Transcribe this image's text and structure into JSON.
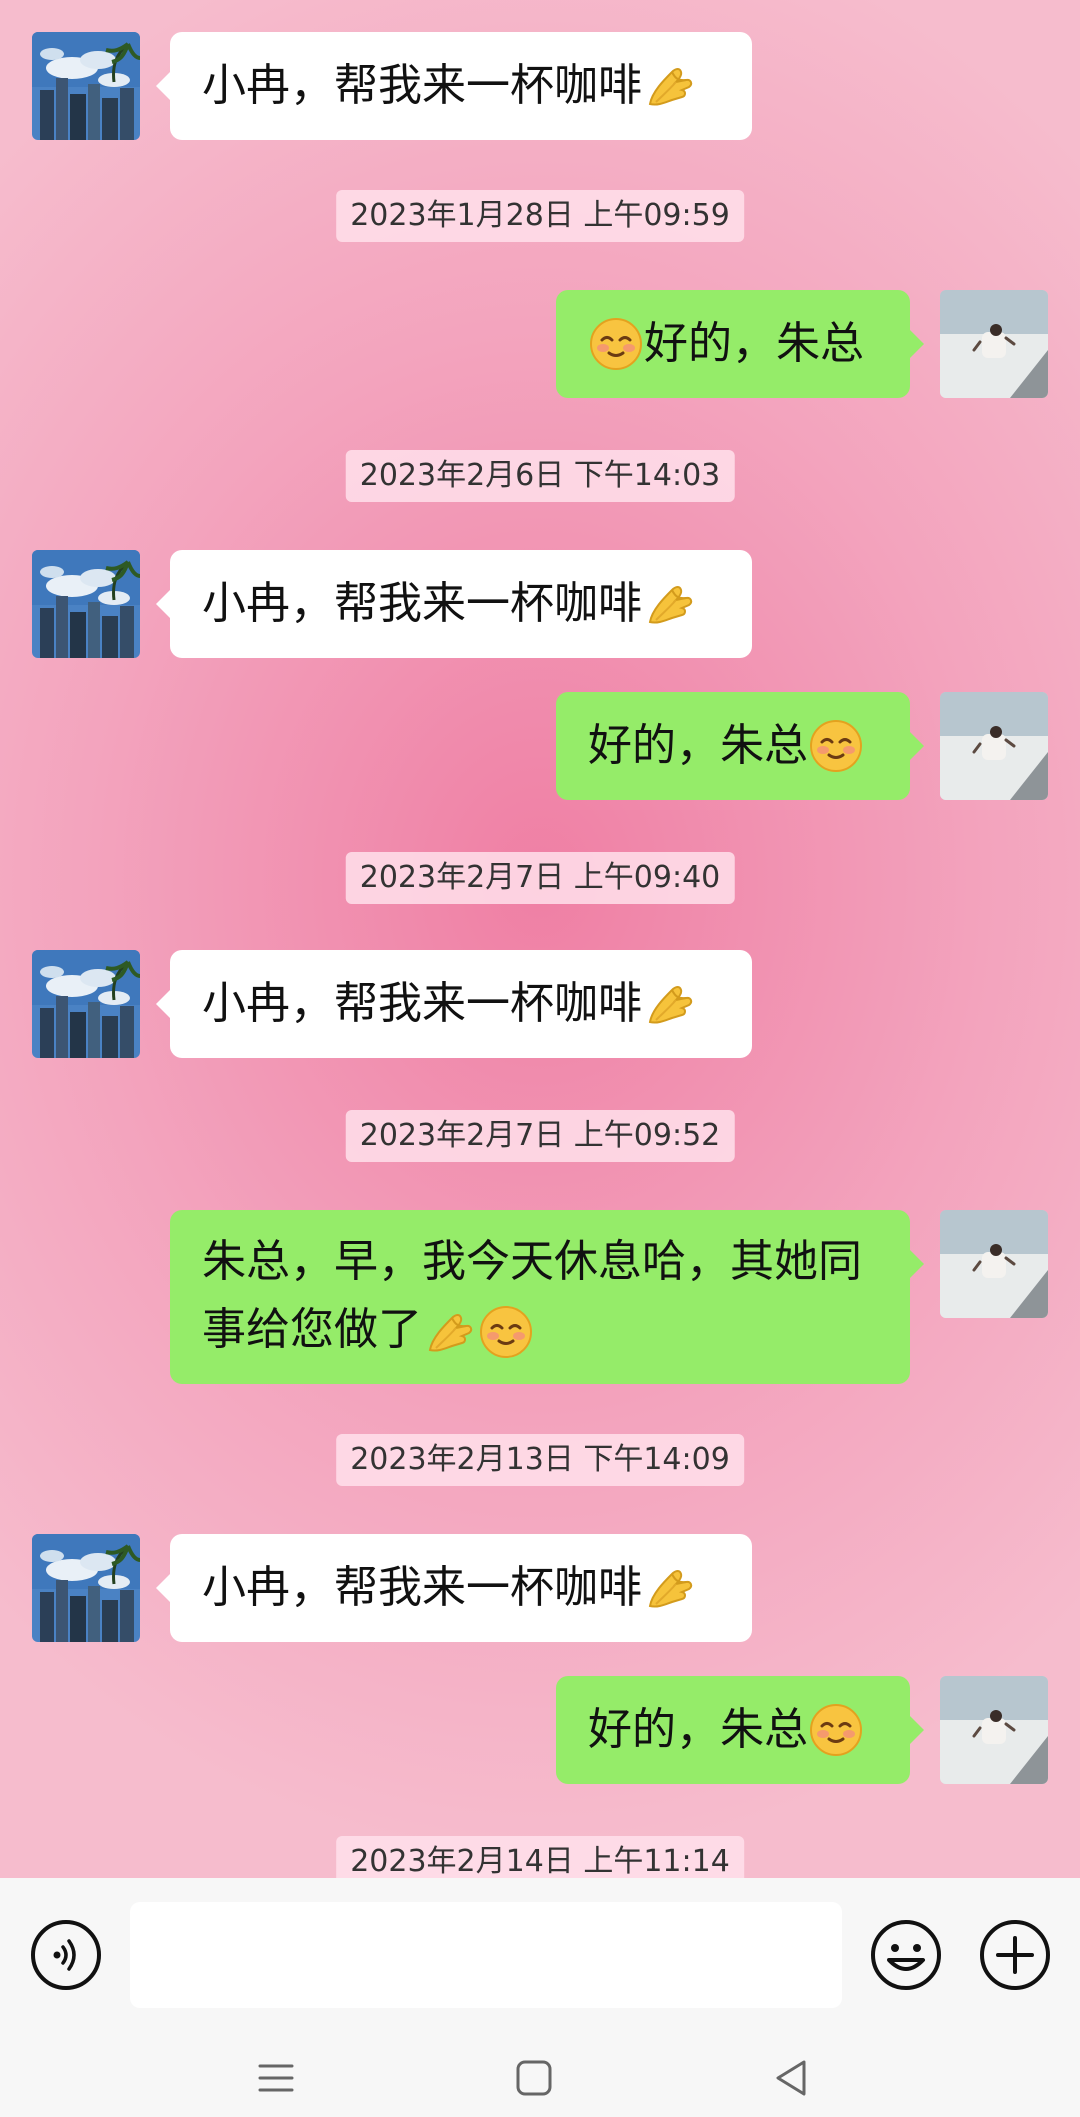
{
  "messages": [
    {
      "side": "left",
      "text": "小冉，帮我来一杯咖啡",
      "emoji": "pinched-fingers-emoji"
    },
    {
      "timestamp": "2023年1月28日 上午09:59"
    },
    {
      "side": "right",
      "text": "好的，朱总",
      "emoji_before": "smiling-face-emoji"
    },
    {
      "timestamp": "2023年2月6日 下午14:03"
    },
    {
      "side": "left",
      "text": "小冉，帮我来一杯咖啡",
      "emoji": "pinched-fingers-emoji"
    },
    {
      "side": "right",
      "text": "好的，朱总",
      "emoji": "smiling-face-emoji"
    },
    {
      "timestamp": "2023年2月7日 上午09:40"
    },
    {
      "side": "left",
      "text": "小冉，帮我来一杯咖啡",
      "emoji": "pinched-fingers-emoji"
    },
    {
      "timestamp": "2023年2月7日 上午09:52"
    },
    {
      "side": "right",
      "line1": "朱总，早，我今天休息哈，其她同",
      "line2": "事给您做了",
      "emojis": [
        "pinched-fingers-emoji",
        "smiling-face-emoji"
      ]
    },
    {
      "timestamp": "2023年2月13日 下午14:09"
    },
    {
      "side": "left",
      "text": "小冉，帮我来一杯咖啡",
      "emoji": "pinched-fingers-emoji"
    },
    {
      "side": "right",
      "text": "好的，朱总",
      "emoji": "smiling-face-emoji"
    },
    {
      "timestamp": "2023年2月14日 上午11:14"
    }
  ],
  "input_bar": {
    "voice_icon": "voice-icon",
    "emoji_icon": "emoji-face-icon",
    "plus_icon": "plus-icon",
    "input_value": ""
  },
  "nav_bar": {
    "icons": [
      "menu-icon",
      "home-icon",
      "back-icon"
    ]
  },
  "colors": {
    "self_bubble": "#95ec69",
    "other_bubble": "#ffffff",
    "background_center": "#ef7fa4",
    "background_edge": "#f6bccd",
    "input_bar": "#f7f7f7"
  }
}
